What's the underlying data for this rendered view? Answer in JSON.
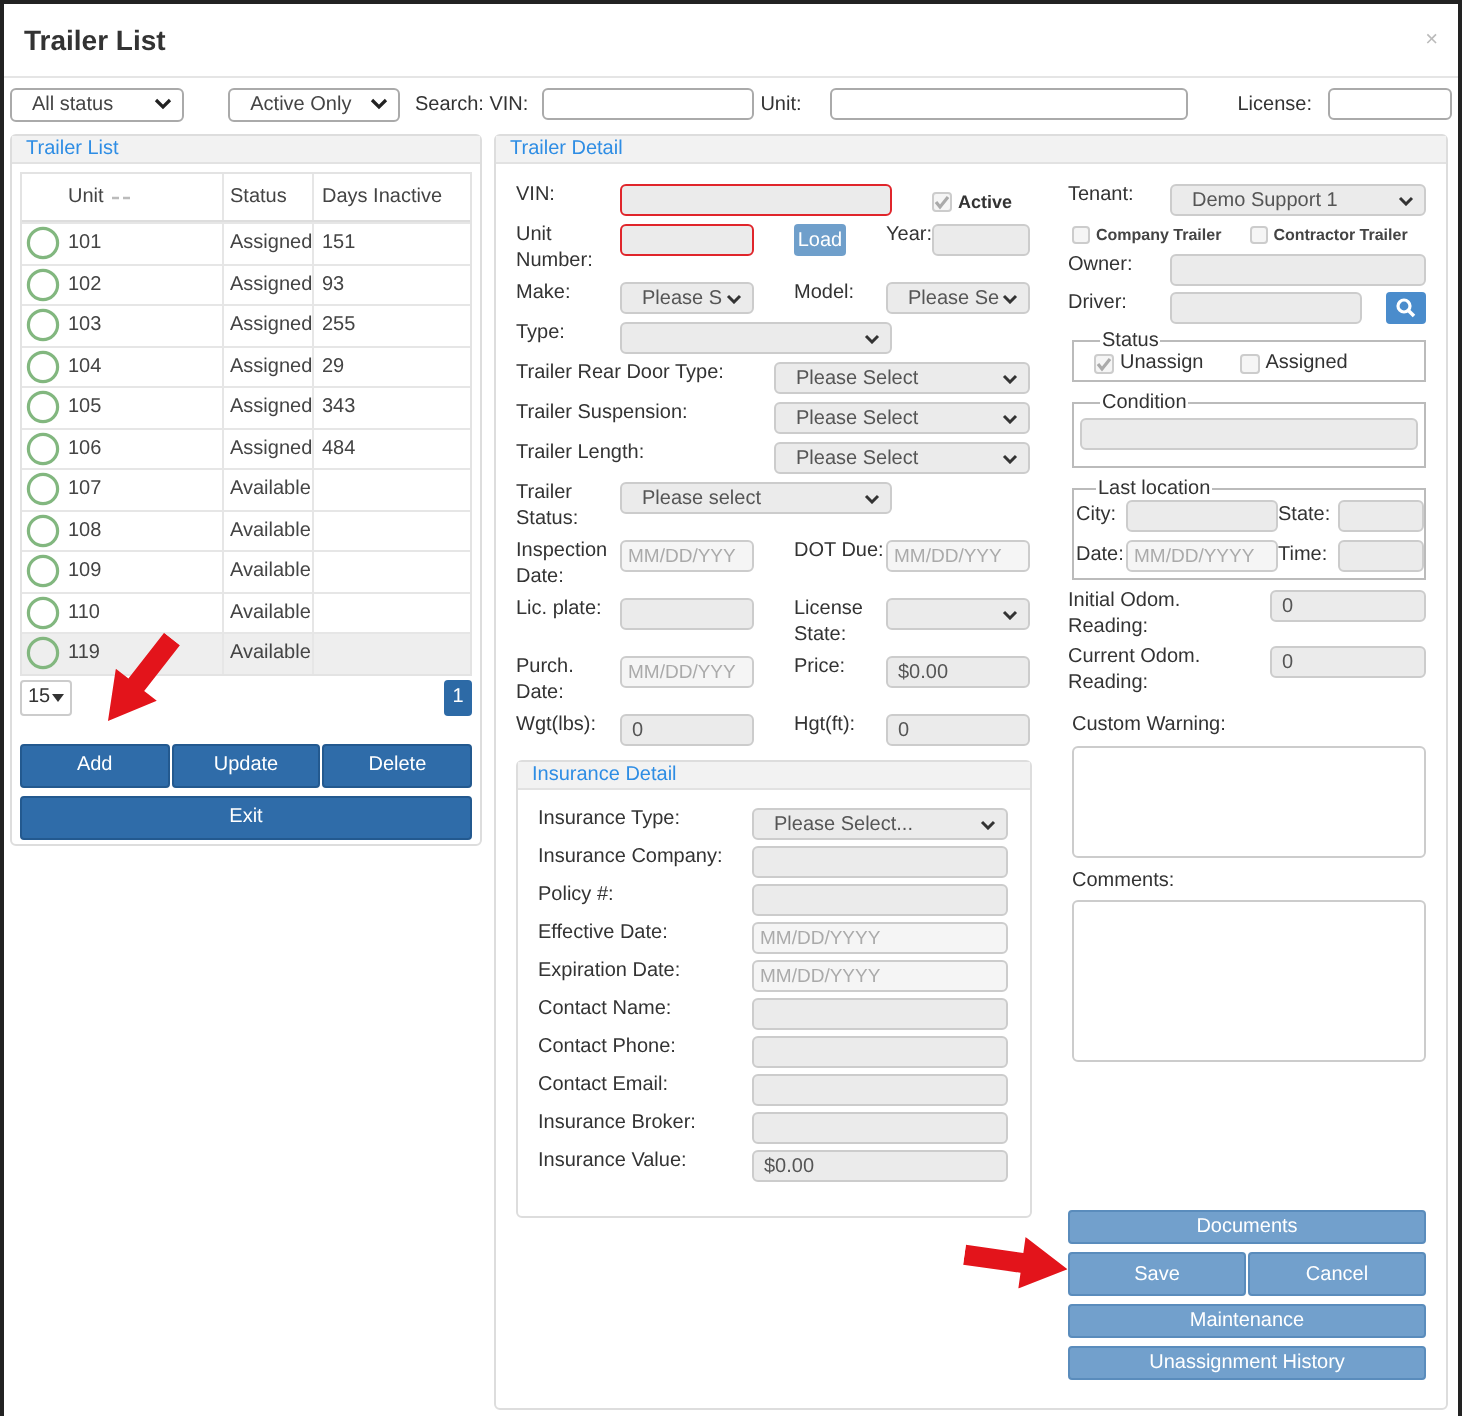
{
  "window": {
    "title": "Trailer List",
    "close": "×"
  },
  "filters": {
    "status": "All status",
    "activity": "Active Only",
    "vin_label": "Search: VIN:",
    "unit_label": "Unit:",
    "license_label": "License:"
  },
  "trailer_list": {
    "title": "Trailer List",
    "columns": [
      "Unit",
      "Status",
      "Days Inactive"
    ],
    "rows": [
      {
        "unit": "101",
        "status": "Assigned",
        "days_inactive": "151",
        "selected": false
      },
      {
        "unit": "102",
        "status": "Assigned",
        "days_inactive": "93",
        "selected": false
      },
      {
        "unit": "103",
        "status": "Assigned",
        "days_inactive": "255",
        "selected": false
      },
      {
        "unit": "104",
        "status": "Assigned",
        "days_inactive": "29",
        "selected": false
      },
      {
        "unit": "105",
        "status": "Assigned",
        "days_inactive": "343",
        "selected": false
      },
      {
        "unit": "106",
        "status": "Assigned",
        "days_inactive": "484",
        "selected": false
      },
      {
        "unit": "107",
        "status": "Available",
        "selected": false
      },
      {
        "unit": "108",
        "status": "Available",
        "selected": false
      },
      {
        "unit": "109",
        "status": "Available",
        "selected": false
      },
      {
        "unit": "110",
        "status": "Available",
        "selected": false
      },
      {
        "unit": "119",
        "status": "Available",
        "selected": true
      }
    ],
    "page_size": "15",
    "pages": [
      {
        "label": "1",
        "selected": true
      }
    ],
    "buttons": [
      "Add",
      "Update",
      "Delete"
    ],
    "exit": "Exit"
  },
  "trailer_detail": {
    "title": "Trailer Detail",
    "rows": [
      {
        "kind": "vin",
        "fields": [
          {
            "label": "VIN:",
            "kind": "text",
            "invalid": true
          },
          {
            "label": "Active",
            "kind": "checkbox",
            "checked": true
          }
        ]
      },
      {
        "kind": "unit",
        "fields": [
          {
            "label": "Unit Number:",
            "kind": "text",
            "invalid": true
          },
          {
            "label": "Load",
            "kind": "button"
          },
          {
            "label": "Year:",
            "kind": "text",
            "invalid": false
          }
        ]
      },
      {
        "kind": "pair",
        "fields": [
          {
            "label": "Make:",
            "kind": "select",
            "value": "Please S",
            "invalid": false
          },
          {
            "label": "Model:",
            "kind": "select",
            "value": "Please Se",
            "invalid": false
          }
        ]
      },
      {
        "kind": "wide",
        "fields": [
          {
            "label": "Type:",
            "kind": "select",
            "invalid": false
          }
        ]
      },
      {
        "kind": "long",
        "fields": [
          {
            "label": "Trailer Rear Door Type:",
            "kind": "select",
            "value": "Please Select",
            "invalid": false
          }
        ]
      },
      {
        "kind": "long",
        "fields": [
          {
            "label": "Trailer Suspension:",
            "kind": "select",
            "value": "Please Select",
            "invalid": false
          }
        ]
      },
      {
        "kind": "long",
        "fields": [
          {
            "label": "Trailer Length:",
            "kind": "select",
            "value": "Please Select",
            "invalid": false
          }
        ]
      },
      {
        "kind": "wide",
        "fields": [
          {
            "label": "Trailer Status:",
            "kind": "select",
            "value": "Please select",
            "invalid": false
          }
        ]
      },
      {
        "kind": "pair",
        "fields": [
          {
            "label": "Inspection Date:",
            "kind": "date",
            "placeholder": "MM/DD/YYY",
            "invalid": false
          },
          {
            "label": "DOT Due:",
            "kind": "date",
            "placeholder": "MM/DD/YYY",
            "invalid": false
          }
        ]
      },
      {
        "kind": "pair",
        "fields": [
          {
            "label": "Lic. plate:",
            "kind": "text",
            "invalid": false
          },
          {
            "label": "License State:",
            "kind": "select",
            "invalid": false
          }
        ]
      },
      {
        "kind": "pair",
        "fields": [
          {
            "label": "Purch. Date:",
            "kind": "date",
            "placeholder": "MM/DD/YYY",
            "invalid": false
          },
          {
            "label": "Price:",
            "kind": "text",
            "value": "$0.00",
            "invalid": false
          }
        ]
      },
      {
        "kind": "pair",
        "fields": [
          {
            "label": "Wgt(lbs):",
            "kind": "text",
            "value": "0",
            "invalid": false
          },
          {
            "label": "Hgt(ft):",
            "kind": "text",
            "value": "0",
            "invalid": false
          }
        ]
      }
    ],
    "insurance": {
      "title": "Insurance Detail",
      "fields": [
        {
          "label": "Insurance Type:",
          "kind": "select",
          "value": "Please Select..."
        },
        {
          "label": "Insurance Company:",
          "kind": "text"
        },
        {
          "label": "Policy #:",
          "kind": "text"
        },
        {
          "label": "Effective Date:",
          "kind": "date",
          "placeholder": "MM/DD/YYYY"
        },
        {
          "label": "Expiration Date:",
          "kind": "date",
          "placeholder": "MM/DD/YYYY"
        },
        {
          "label": "Contact Name:",
          "kind": "text"
        },
        {
          "label": "Contact Phone:",
          "kind": "text"
        },
        {
          "label": "Contact Email:",
          "kind": "text"
        },
        {
          "label": "Insurance Broker:",
          "kind": "text"
        },
        {
          "label": "Insurance Value:",
          "kind": "text",
          "value": "$0.00"
        }
      ]
    },
    "tenant": {
      "label": "Tenant:",
      "value": "Demo Support 1"
    },
    "ownership": [
      {
        "label": "Company Trailer",
        "checked": false
      },
      {
        "label": "Contractor Trailer",
        "checked": false
      }
    ],
    "owner": {
      "label": "Owner:"
    },
    "driver": {
      "label": "Driver:"
    },
    "status": {
      "title": "Status",
      "options": [
        {
          "label": "Unassign",
          "checked": true
        },
        {
          "label": "Assigned",
          "checked": false
        }
      ]
    },
    "condition": {
      "title": "Condition"
    },
    "last_location": {
      "title": "Last location",
      "fields": [
        {
          "label": "City:"
        },
        {
          "label": "State:"
        },
        {
          "label": "Date:",
          "placeholder": "MM/DD/YYYY"
        },
        {
          "label": "Time:"
        }
      ]
    },
    "odometer": [
      {
        "label": "Initial Odom. Reading:",
        "value": "0"
      },
      {
        "label": "Current Odom. Reading:",
        "value": "0"
      }
    ],
    "custom_warning": {
      "label": "Custom Warning:"
    },
    "comments": {
      "label": "Comments:"
    },
    "button_rows": [
      [
        "Documents"
      ],
      [
        "Save",
        "Cancel"
      ],
      [
        "Maintenance"
      ],
      [
        "Unassignment History"
      ]
    ]
  },
  "annotation_arrows": [
    {
      "kind": "arrow"
    },
    {
      "kind": "arrow"
    }
  ]
}
